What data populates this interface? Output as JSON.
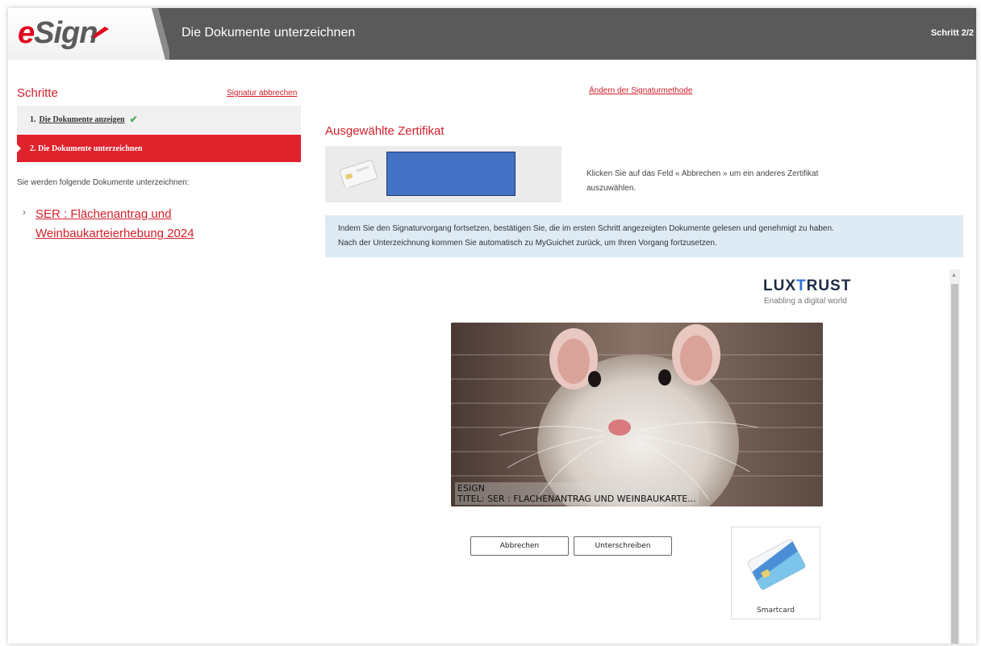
{
  "app": {
    "logo_text": "eSign",
    "title": "Die Dokumente unterzeichnen",
    "step_indicator": "Schritt 2/2"
  },
  "sidebar": {
    "title": "Schritte",
    "cancel_link": "Signatur abbrechen",
    "steps": [
      {
        "number": "1.",
        "label": "Die Dokumente anzeigen",
        "status": "done"
      },
      {
        "number": "2.",
        "label": "2. Die Dokumente unterzeichnen",
        "status": "active"
      }
    ],
    "intro": "Sie werden folgende Dokumente unterzeichnen:",
    "document_link": "SER : Flächenantrag und Weinbaukarteierhebung 2024"
  },
  "main": {
    "change_method_link": "Ändern der Signaturmethode",
    "certificate_title": "Ausgewählte Zertifikat",
    "certificate_hint": "Klicken Sie auf das Feld « Abbrechen » um ein anderes Zertifikat auszuwählen.",
    "info_line1": "Indem Sie den Signaturvorgang fortsetzen, bestätigen Sie, die im ersten Schritt angezeigten Dokumente gelesen und genehmigt zu haben.",
    "info_line2": "Nach der Unterzeichnung kommen Sie automatisch zu MyGuichet zurück, um Ihren Vorgang fortzusetzen."
  },
  "luxtrust": {
    "logo_left": "LUX",
    "logo_mid": "T",
    "logo_right": "RUST",
    "tagline": "Enabling a digital world",
    "caption_line1": "ESIGN",
    "caption_line2": "TITEL: SER : FLACHENANTRAG UND WEINBAUKARTE...",
    "cancel_button": "Abbrechen",
    "sign_button": "Unterschreiben",
    "smartcard_label": "Smartcard"
  },
  "colors": {
    "brand_red": "#e0222c",
    "header_gray": "#5a5a5a",
    "info_blue": "#deebf4",
    "redacted_blue": "#4472c4"
  }
}
